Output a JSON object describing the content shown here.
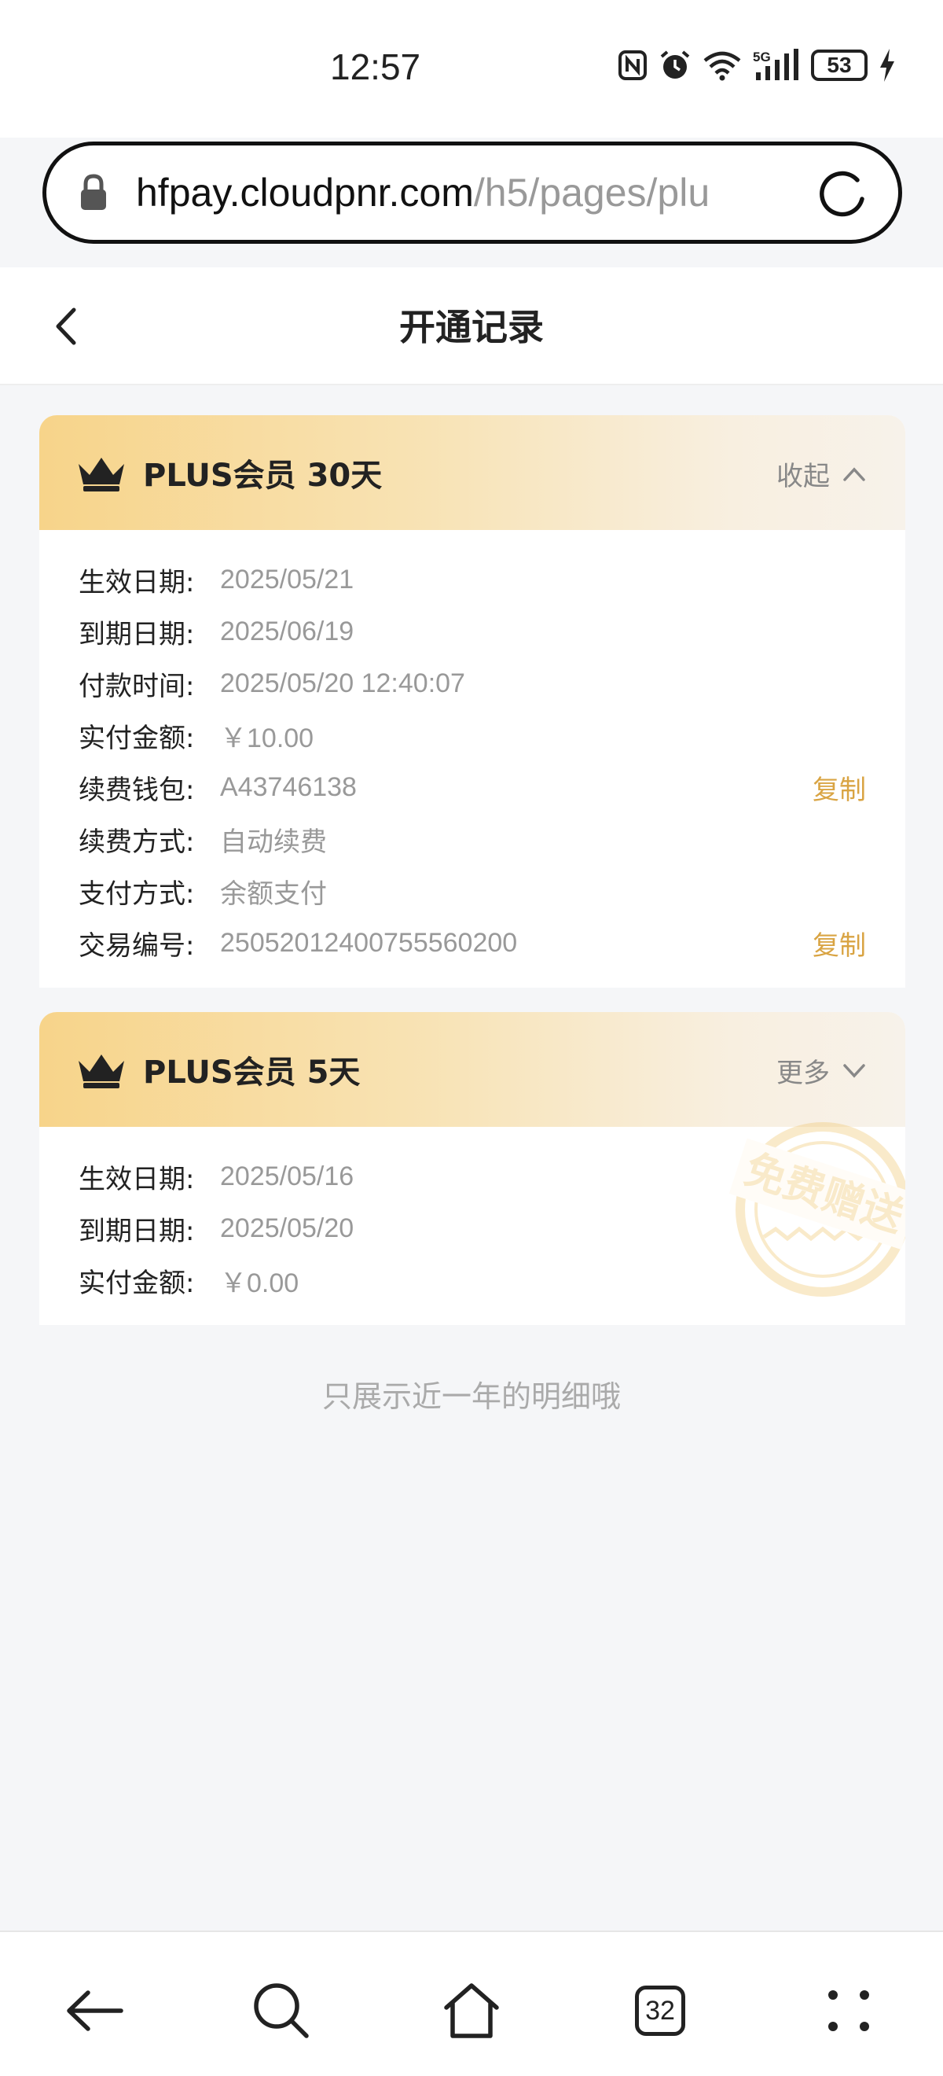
{
  "status_bar": {
    "time": "12:57",
    "battery": "53",
    "icons": [
      "nfc-icon",
      "alarm-icon",
      "wifi-icon",
      "5g-signal-icon",
      "battery-icon",
      "charging-icon"
    ],
    "network_label": "5G"
  },
  "browser": {
    "url_host": "hfpay.cloudpnr.com",
    "url_path": "/h5/pages/plu",
    "tab_count": "32"
  },
  "header": {
    "title": "开通记录"
  },
  "records": [
    {
      "title": "PLUS会员 30天",
      "toggle_label": "收起",
      "expanded": true,
      "fields": [
        {
          "label": "生效日期:",
          "value": "2025/05/21"
        },
        {
          "label": "到期日期:",
          "value": "2025/06/19"
        },
        {
          "label": "付款时间:",
          "value": "2025/05/20 12:40:07"
        },
        {
          "label": "实付金额:",
          "value": "￥10.00"
        },
        {
          "label": "续费钱包:",
          "value": "A43746138",
          "action": "复制"
        },
        {
          "label": "续费方式:",
          "value": "自动续费"
        },
        {
          "label": "支付方式:",
          "value": "余额支付"
        },
        {
          "label": "交易编号:",
          "value": "25052012400755560200",
          "action": "复制"
        }
      ]
    },
    {
      "title": "PLUS会员 5天",
      "toggle_label": "更多",
      "expanded": false,
      "stamp": "免费赠送",
      "fields": [
        {
          "label": "生效日期:",
          "value": "2025/05/16"
        },
        {
          "label": "到期日期:",
          "value": "2025/05/20"
        },
        {
          "label": "实付金额:",
          "value": "￥0.00"
        }
      ]
    }
  ],
  "footnote": "只展示近一年的明细哦",
  "colors": {
    "accent_gold": "#d9a443",
    "header_gradient_start": "#f7d48a",
    "header_gradient_end": "#f7f2ea",
    "page_background": "#f5f6f8"
  }
}
